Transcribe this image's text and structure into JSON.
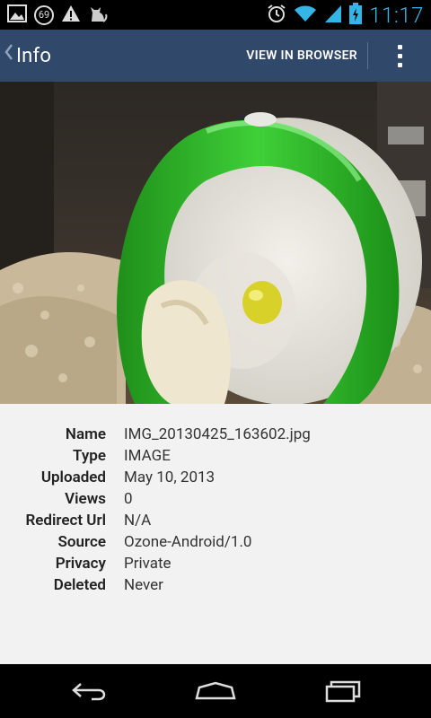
{
  "status_bar": {
    "notification_count": "69",
    "clock": "11:17",
    "icons": [
      "gallery-icon",
      "notification-count-icon",
      "warning-icon",
      "cat-icon",
      "alarm-icon",
      "wifi-icon",
      "signal-icon",
      "battery-icon"
    ]
  },
  "action_bar": {
    "title": "Info",
    "view_in_browser": "VIEW IN BROWSER",
    "background_color": "#30486a"
  },
  "photo": {
    "subject": "hamster-in-wheel",
    "accent_color": "#2fb52a"
  },
  "info": {
    "rows": [
      {
        "label": "Name",
        "value": "IMG_20130425_163602.jpg"
      },
      {
        "label": "Type",
        "value": "IMAGE"
      },
      {
        "label": "Uploaded",
        "value": "May 10, 2013"
      },
      {
        "label": "Views",
        "value": "0"
      },
      {
        "label": "Redirect Url",
        "value": "N/A"
      },
      {
        "label": "Source",
        "value": "Ozone-Android/1.0"
      },
      {
        "label": "Privacy",
        "value": "Private"
      },
      {
        "label": "Deleted",
        "value": "Never"
      }
    ]
  },
  "nav_bar": {
    "icons": [
      "back-icon",
      "home-icon",
      "recent-apps-icon"
    ]
  }
}
